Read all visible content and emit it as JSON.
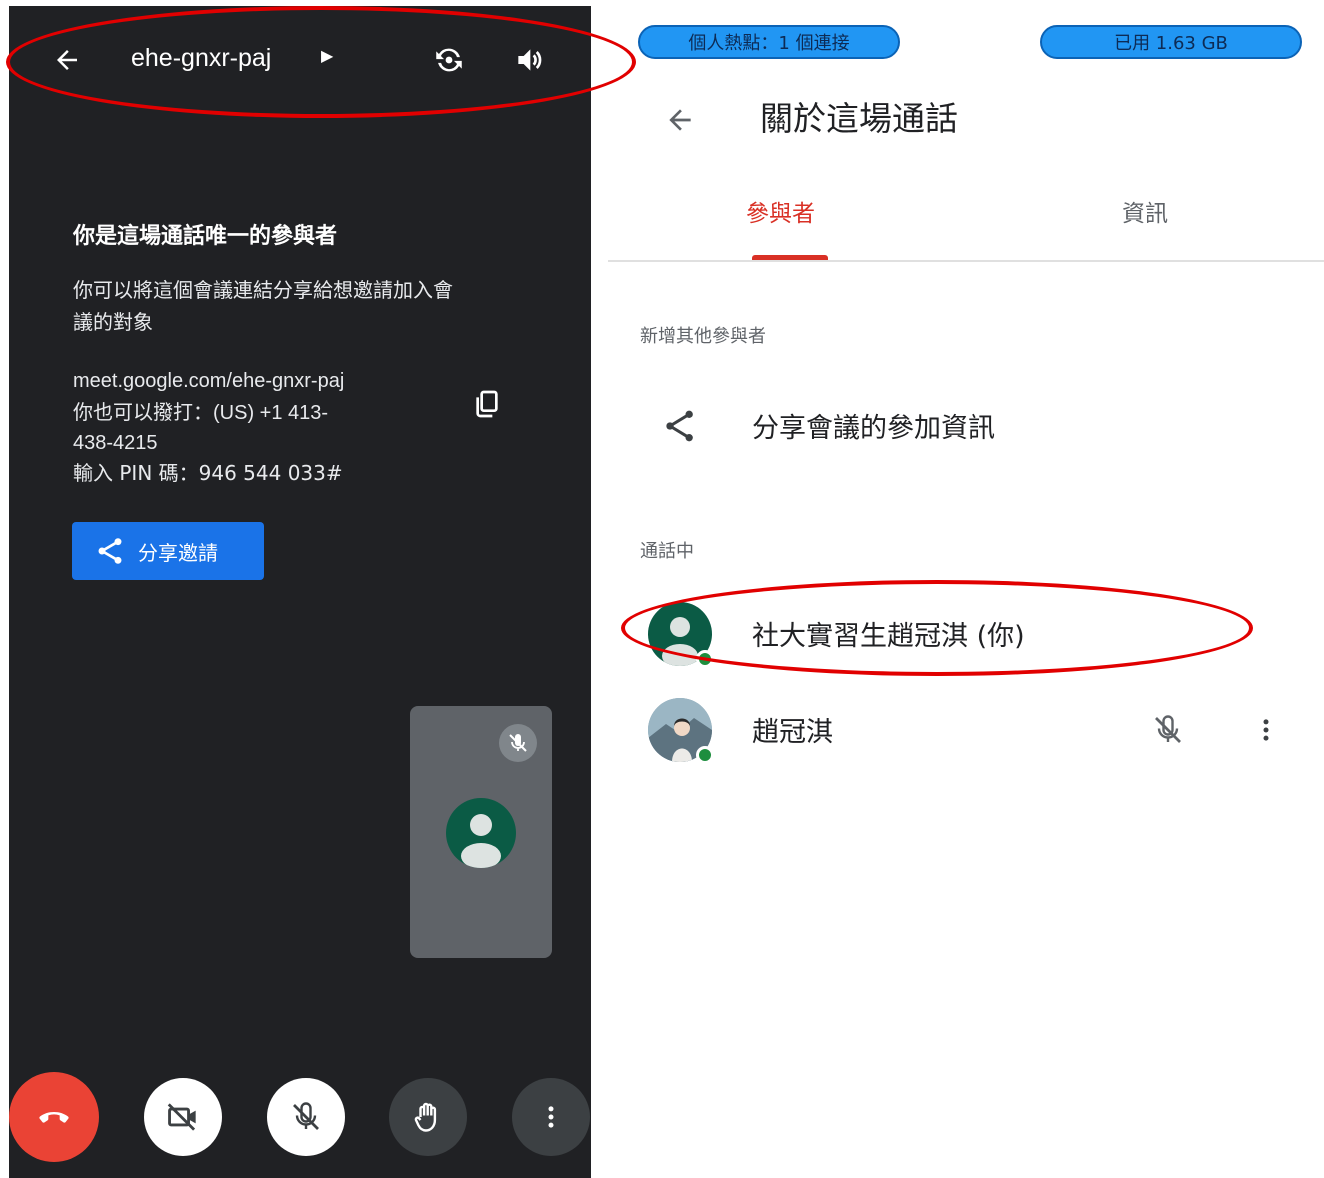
{
  "meeting": {
    "code": "ehe-gnxr-paj",
    "alone_title": "你是這場通話唯一的參與者",
    "alone_desc": "你可以將這個會議連結分享給想邀請加入會議的對象",
    "link": "meet.google.com/ehe-gnxr-paj",
    "dial_in": "你也可以撥打：(US) +1 413-438-4215",
    "pin": "輸入 PIN 碼：946 544 033#",
    "share_invite_label": "分享邀請"
  },
  "status_bar": {
    "hotspot": "個人熱點：1 個連接",
    "data_used": "已用 1.63 GB"
  },
  "about": {
    "title": "關於這場通話",
    "tabs": [
      {
        "label": "參與者",
        "active": true
      },
      {
        "label": "資訊",
        "active": false
      }
    ],
    "add_section": "新增其他參與者",
    "share_info_label": "分享會議的參加資訊",
    "in_call_section": "通話中",
    "participants": [
      {
        "name": "社大實習生趙冠淇 (你)",
        "avatar": "default-person-avatar"
      },
      {
        "name": "趙冠淇",
        "avatar": "photo-avatar",
        "muted": true
      }
    ]
  },
  "colors": {
    "dark_bg": "#202124",
    "accent_blue": "#1a73e8",
    "end_call_red": "#ea4335",
    "tab_active": "#d93025",
    "annotation_red": "#e10000",
    "status_pill": "#2196f3"
  }
}
